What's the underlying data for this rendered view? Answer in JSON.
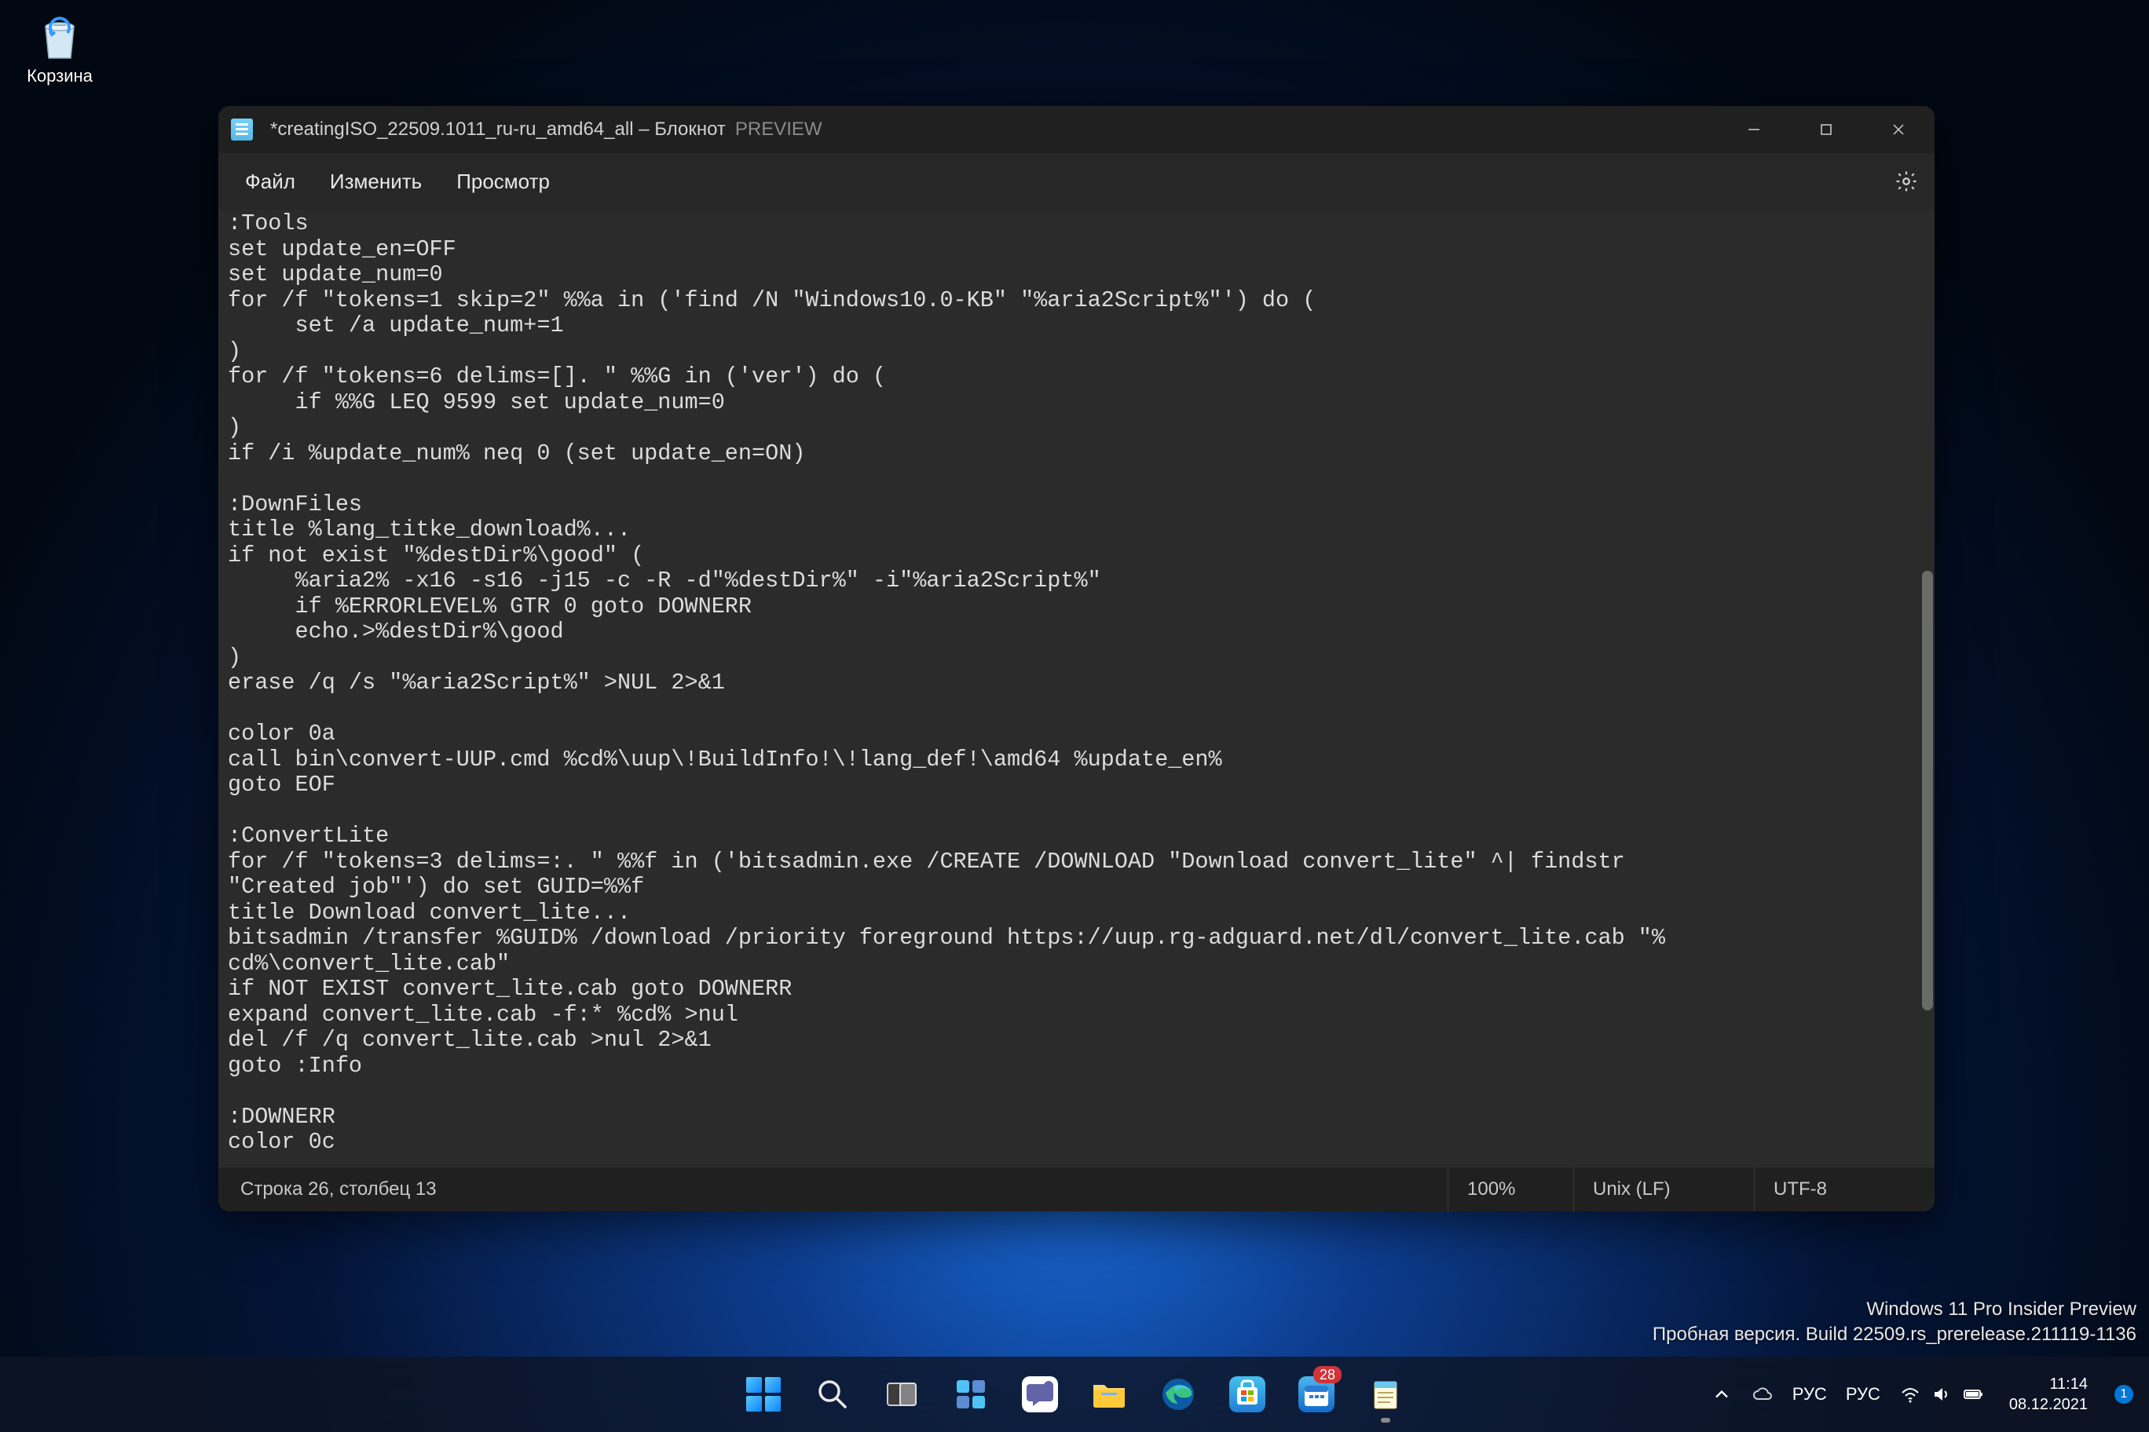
{
  "desktop": {
    "recycle_label": "Корзина"
  },
  "window": {
    "title": "*creatingISO_22509.1011_ru-ru_amd64_all – Блокнот",
    "preview_tag": "PREVIEW"
  },
  "menu": {
    "file": "Файл",
    "edit": "Изменить",
    "view": "Просмотр"
  },
  "editor_text": ":Tools\nset update_en=OFF\nset update_num=0\nfor /f \"tokens=1 skip=2\" %%a in ('find /N \"Windows10.0-KB\" \"%aria2Script%\"') do (\n     set /a update_num+=1\n)\nfor /f \"tokens=6 delims=[]. \" %%G in ('ver') do (\n     if %%G LEQ 9599 set update_num=0\n)\nif /i %update_num% neq 0 (set update_en=ON)\n\n:DownFiles\ntitle %lang_titke_download%...\nif not exist \"%destDir%\\good\" (\n     %aria2% -x16 -s16 -j15 -c -R -d\"%destDir%\" -i\"%aria2Script%\"\n     if %ERRORLEVEL% GTR 0 goto DOWNERR\n     echo.>%destDir%\\good\n)\nerase /q /s \"%aria2Script%\" >NUL 2>&1\n\ncolor 0a\ncall bin\\convert-UUP.cmd %cd%\\uup\\!BuildInfo!\\!lang_def!\\amd64 %update_en%\ngoto EOF\n\n:ConvertLite\nfor /f \"tokens=3 delims=:. \" %%f in ('bitsadmin.exe /CREATE /DOWNLOAD \"Download convert_lite\" ^| findstr \n\"Created job\"') do set GUID=%%f\ntitle Download convert_lite...\nbitsadmin /transfer %GUID% /download /priority foreground https://uup.rg-adguard.net/dl/convert_lite.cab \"%\ncd%\\convert_lite.cab\"\nif NOT EXIST convert_lite.cab goto DOWNERR\nexpand convert_lite.cab -f:* %cd% >nul\ndel /f /q convert_lite.cab >nul 2>&1\ngoto :Info\n\n:DOWNERR\ncolor 0c",
  "status": {
    "position": "Строка 26, столбец 13",
    "zoom": "100%",
    "line_endings": "Unix (LF)",
    "encoding": "UTF-8"
  },
  "watermark": {
    "line1": "Windows 11 Pro Insider Preview",
    "line2": "Пробная версия. Build 22509.rs_prerelease.211119-1136"
  },
  "taskbar": {
    "lang1": "РУС",
    "lang2": "РУС",
    "time": "11:14",
    "date": "08.12.2021",
    "calendar_badge": "28",
    "notif_count": "1"
  }
}
